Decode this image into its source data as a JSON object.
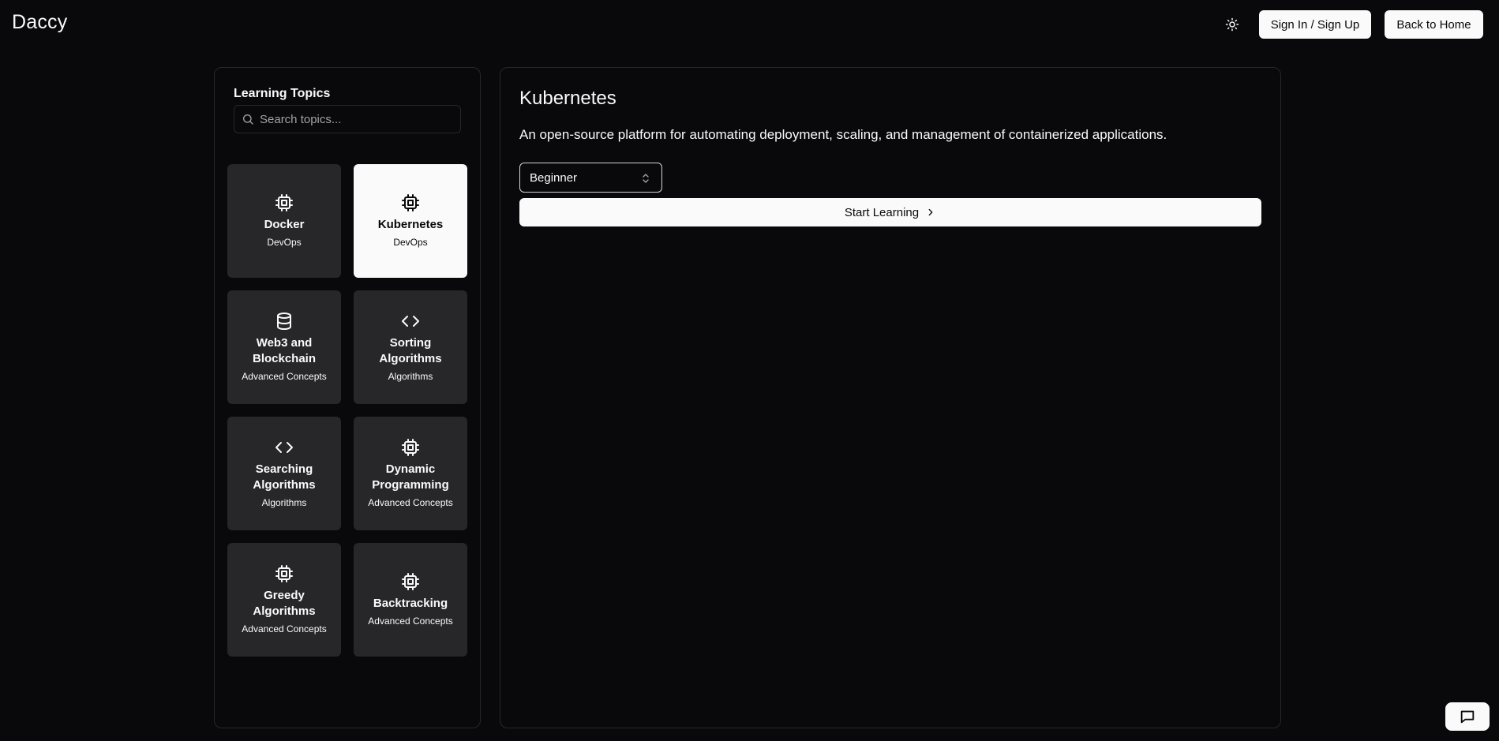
{
  "header": {
    "brand": "Daccy",
    "theme_toggle_icon": "sun-icon",
    "signin_label": "Sign In / Sign Up",
    "home_label": "Back to Home"
  },
  "sidebar": {
    "title": "Learning Topics",
    "search_placeholder": "Search topics...",
    "search_value": "",
    "topics": [
      {
        "name": "Docker",
        "category": "DevOps",
        "icon": "cpu-icon",
        "active": false
      },
      {
        "name": "Kubernetes",
        "category": "DevOps",
        "icon": "cpu-icon",
        "active": true
      },
      {
        "name": "Web3 and Blockchain",
        "category": "Advanced Concepts",
        "icon": "database-icon",
        "active": false
      },
      {
        "name": "Sorting Algorithms",
        "category": "Algorithms",
        "icon": "code-icon",
        "active": false
      },
      {
        "name": "Searching Algorithms",
        "category": "Algorithms",
        "icon": "code-icon",
        "active": false
      },
      {
        "name": "Dynamic Programming",
        "category": "Advanced Concepts",
        "icon": "cpu-icon",
        "active": false
      },
      {
        "name": "Greedy Algorithms",
        "category": "Advanced Concepts",
        "icon": "cpu-icon",
        "active": false
      },
      {
        "name": "Backtracking",
        "category": "Advanced Concepts",
        "icon": "cpu-icon",
        "active": false
      }
    ]
  },
  "main": {
    "title": "Kubernetes",
    "description": "An open-source platform for automating deployment, scaling, and management of containerized applications.",
    "level_selected": "Beginner",
    "start_label": "Start Learning"
  },
  "colors": {
    "background": "#09090b",
    "card": "#27272a",
    "card_active": "#fafafa",
    "border": "#27272a",
    "text": "#fafafa"
  }
}
